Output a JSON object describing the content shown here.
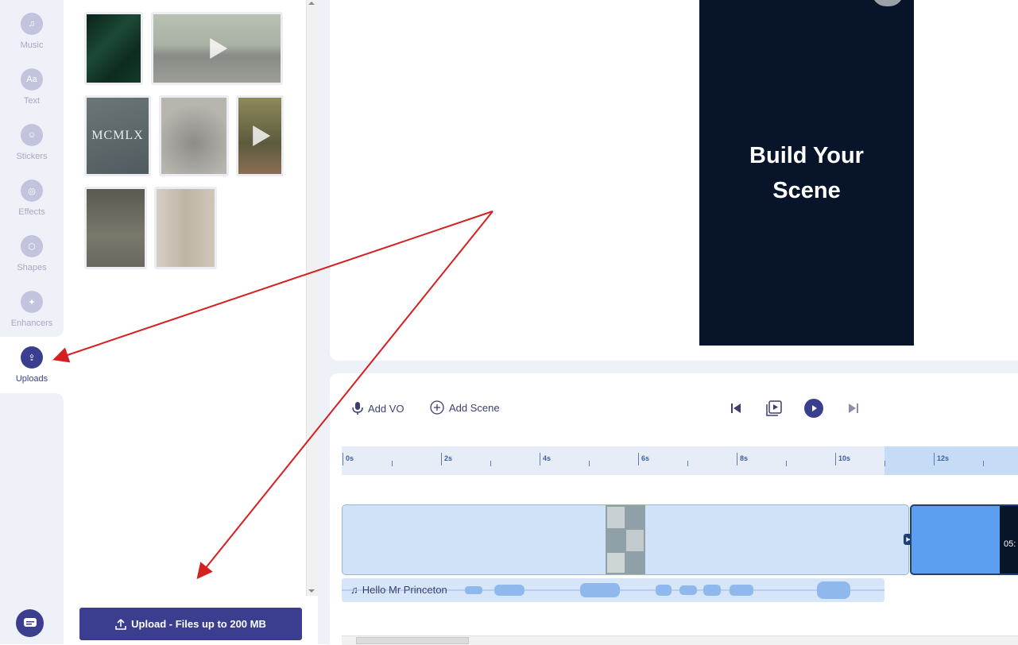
{
  "sidebar": {
    "items": [
      {
        "label": "Music",
        "icon": "music-note-icon",
        "glyph": "♫"
      },
      {
        "label": "Text",
        "icon": "text-icon",
        "glyph": "Aa"
      },
      {
        "label": "Stickers",
        "icon": "smiley-icon",
        "glyph": "☺"
      },
      {
        "label": "Effects",
        "icon": "effects-icon",
        "glyph": "◎"
      },
      {
        "label": "Shapes",
        "icon": "hexagon-icon",
        "glyph": "⬡"
      },
      {
        "label": "Enhancers",
        "icon": "magic-wand-icon",
        "glyph": "✦"
      },
      {
        "label": "Uploads",
        "icon": "upload-icon",
        "glyph": "⇪"
      }
    ],
    "active": "Uploads"
  },
  "media": {
    "thumbnails": [
      {
        "kind": "image",
        "desc": "pine",
        "color": "#0f2d22"
      },
      {
        "kind": "video",
        "desc": "street",
        "color": "#9aa39a"
      },
      {
        "kind": "image",
        "desc": "book",
        "color": "#5e6b6e",
        "text": "MCMLX"
      },
      {
        "kind": "image",
        "desc": "shoes",
        "color": "#a8a6a0"
      },
      {
        "kind": "video",
        "desc": "tree",
        "color": "#7d7a55"
      },
      {
        "kind": "image",
        "desc": "cat",
        "color": "#6f6d62"
      },
      {
        "kind": "image",
        "desc": "bottle",
        "color": "#c7bfb2"
      }
    ],
    "upload_button": "Upload - Files up to 200 MB"
  },
  "canvas": {
    "scene_title": "Build Your Scene",
    "scene_bg": "#07142a"
  },
  "toolbar": {
    "add_vo": "Add VO",
    "add_scene": "Add Scene"
  },
  "timeline": {
    "ruler": [
      "0s",
      "2s",
      "4s",
      "6s",
      "8s",
      "10s",
      "12s"
    ],
    "audio_track": "Hello Mr Princeton",
    "clip_time_partial": "05:"
  },
  "colors": {
    "accent": "#3b3e8f",
    "timeline_clip": "#cfe2f8",
    "selected_clip": "#5c9ff0"
  }
}
